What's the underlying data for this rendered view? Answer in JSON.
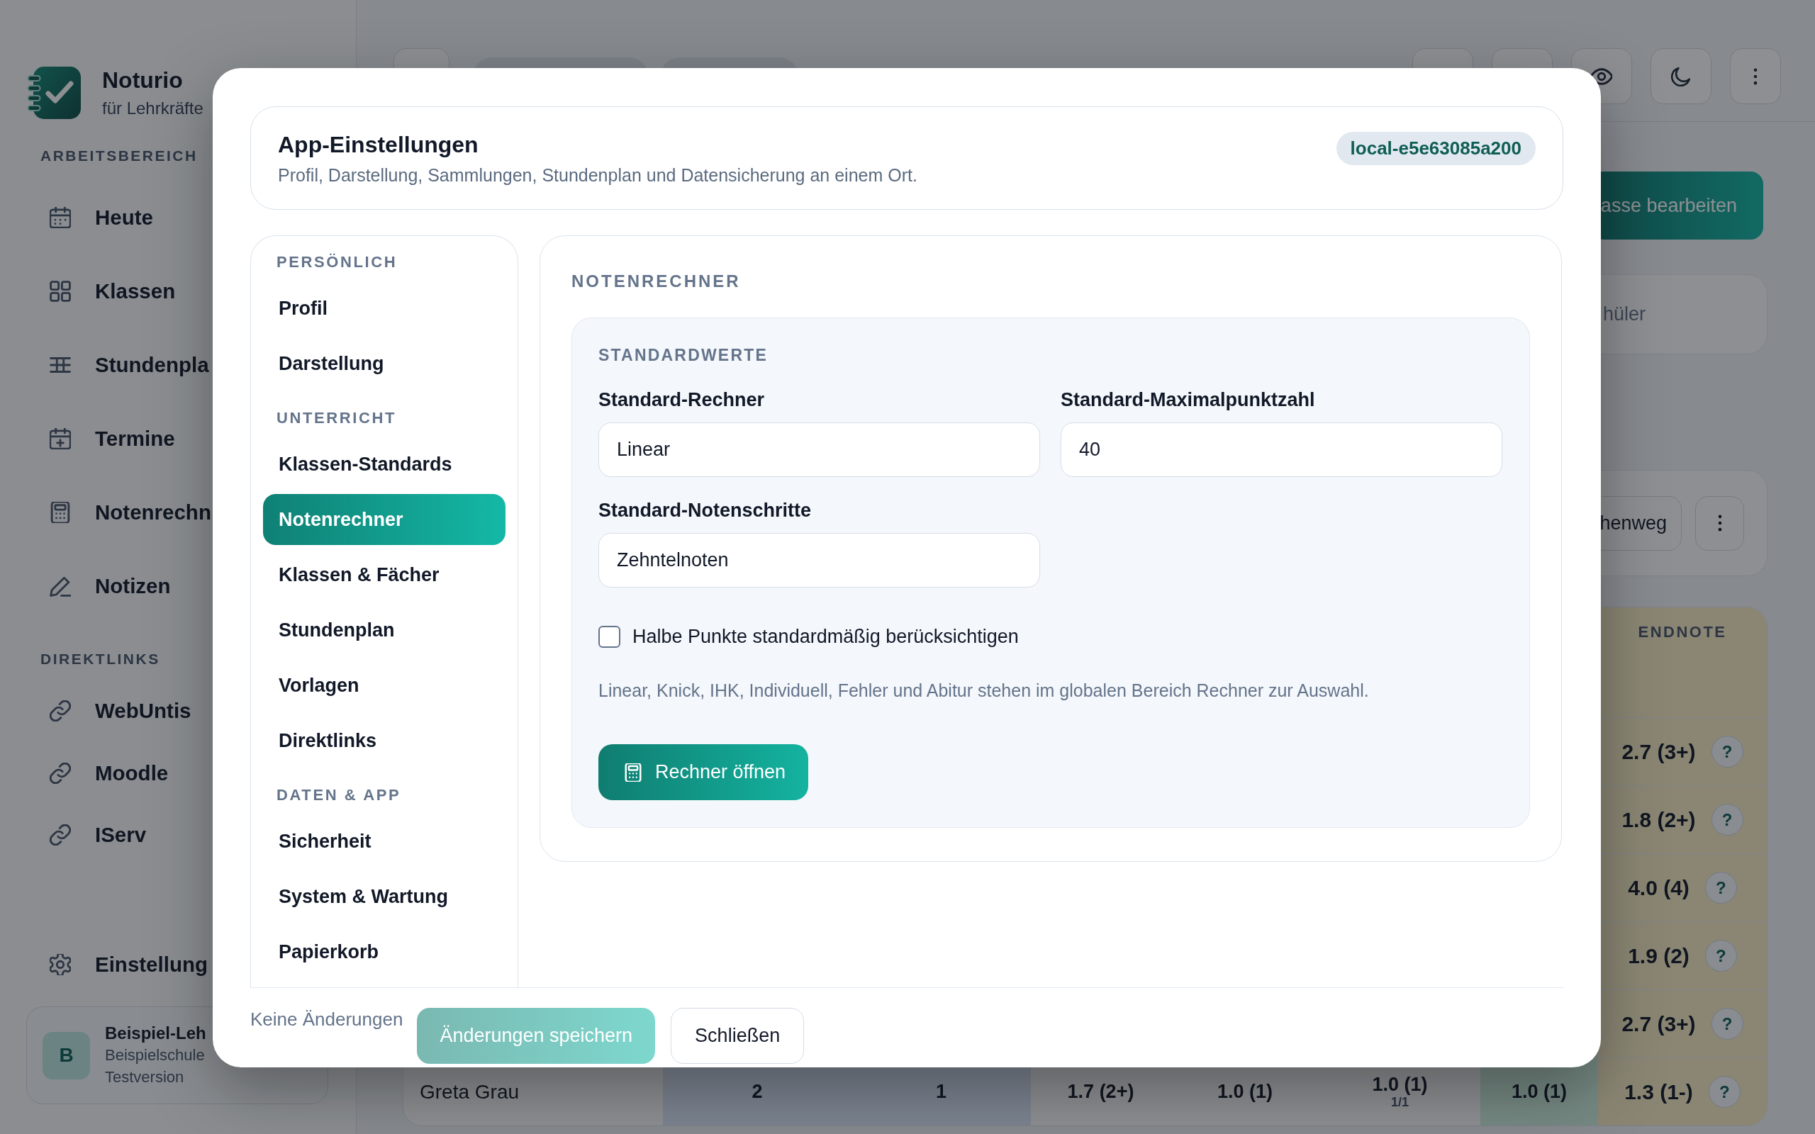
{
  "sidebar": {
    "brand": {
      "name": "Noturio",
      "tagline": "für Lehrkräfte"
    },
    "sections": [
      {
        "heading": "ARBEITSBEREICH",
        "items": [
          {
            "label": "Heute",
            "selected": false
          },
          {
            "label": "Klassen",
            "selected": false
          },
          {
            "label": "Stundenpla",
            "selected": false
          },
          {
            "label": "Termine",
            "selected": false
          },
          {
            "label": "Notenrechn",
            "selected": false
          },
          {
            "label": "Notizen",
            "selected": false
          }
        ]
      },
      {
        "heading": "DIREKTLINKS",
        "items": [
          {
            "label": "WebUntis"
          },
          {
            "label": "Moodle"
          },
          {
            "label": "IServ"
          }
        ]
      }
    ],
    "settings": {
      "label": "Einstellung"
    },
    "user": {
      "initial": "B",
      "name": "Beispiel-Leh",
      "school": "Beispielschule",
      "plan": "Testversion"
    }
  },
  "main": {
    "edit_button": "asse bearbeiten",
    "summary": "hüler",
    "toolbar_button": "henweg",
    "table": {
      "final_header": "ENDNOTE",
      "rows": [
        {
          "final": "2.7 (3+)",
          "help": "?"
        },
        {
          "final": "1.8 (2+)",
          "help": "?"
        },
        {
          "final": "4.0 (4)",
          "help": "?"
        },
        {
          "final": "1.9 (2)",
          "help": "?"
        },
        {
          "final": "2.7 (3+)",
          "help": "?"
        },
        {
          "name": "Greta Grau",
          "cells": [
            {
              "value": "2"
            },
            {
              "value": "1"
            },
            {
              "value": "1.7 (2+)"
            },
            {
              "value": "1.0 (1)"
            },
            {
              "value": "1.0 (1)",
              "note": "1/1"
            },
            {
              "value": "1.0 (1)"
            }
          ],
          "final": "1.3 (1-)",
          "help": "?"
        }
      ]
    }
  },
  "dialog": {
    "title": "App-Einstellungen",
    "subtitle": "Profil, Darstellung, Sammlungen, Stundenplan und Datensicherung an einem Ort.",
    "badge": "local-e5e63085a200",
    "nav": [
      {
        "heading": "PERSÖNLICH",
        "items": [
          {
            "label": "Profil",
            "selected": false
          },
          {
            "label": "Darstellung",
            "selected": false
          }
        ]
      },
      {
        "heading": "UNTERRICHT",
        "items": [
          {
            "label": "Klassen-Standards",
            "selected": false
          },
          {
            "label": "Notenrechner",
            "selected": true
          },
          {
            "label": "Klassen & Fächer",
            "selected": false
          },
          {
            "label": "Stundenplan",
            "selected": false
          },
          {
            "label": "Vorlagen",
            "selected": false
          },
          {
            "label": "Direktlinks",
            "selected": false
          }
        ]
      },
      {
        "heading": "DATEN & APP",
        "items": [
          {
            "label": "Sicherheit",
            "selected": false
          },
          {
            "label": "System & Wartung",
            "selected": false
          },
          {
            "label": "Papierkorb",
            "selected": false
          }
        ]
      }
    ],
    "panel": {
      "title": "NOTENRECHNER",
      "group": {
        "title": "STANDARDWERTE",
        "fields": [
          {
            "label": "Standard-Rechner",
            "value": "Linear"
          },
          {
            "label": "Standard-Maximalpunktzahl",
            "value": "40"
          },
          {
            "label": "Standard-Notenschritte",
            "value": "Zehntelnoten"
          }
        ],
        "checkbox": {
          "label": "Halbe Punkte standardmäßig berücksichtigen",
          "checked": false
        },
        "note": "Linear, Knick, IHK, Individuell, Fehler und Abitur stehen im globalen Bereich Rechner zur Auswahl.",
        "button": "Rechner öffnen"
      }
    },
    "footer": {
      "status": "Keine Änderungen",
      "save": {
        "label": "Änderungen speichern",
        "disabled": true
      },
      "close": "Schließen"
    }
  }
}
